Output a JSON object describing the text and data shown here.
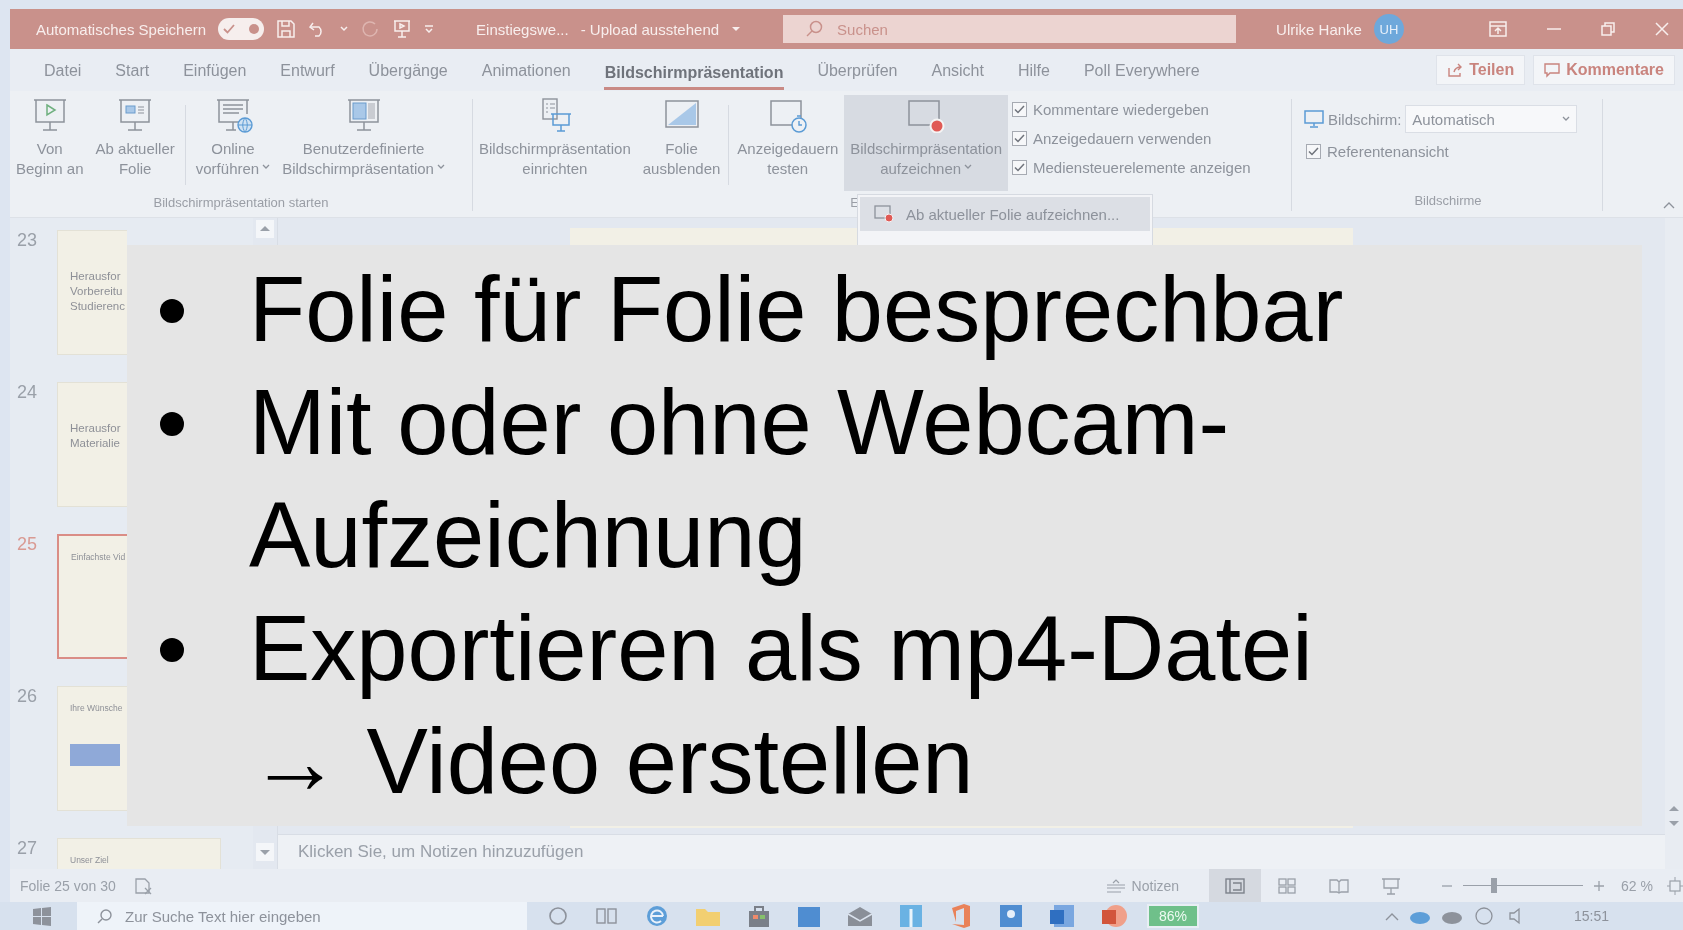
{
  "title_bar": {
    "autosave_label": "Automatisches Speichern",
    "autosave_on": true,
    "document_title": "Einstiegswe...",
    "upload_status": "- Upload ausstehend",
    "search_placeholder": "Suchen",
    "user_name": "Ulrike Hanke",
    "user_initials": "UH"
  },
  "tabs": [
    {
      "label": "Datei",
      "selected": false
    },
    {
      "label": "Start",
      "selected": false
    },
    {
      "label": "Einfügen",
      "selected": false
    },
    {
      "label": "Entwurf",
      "selected": false
    },
    {
      "label": "Übergänge",
      "selected": false
    },
    {
      "label": "Animationen",
      "selected": false
    },
    {
      "label": "Bildschirmpräsentation",
      "selected": true
    },
    {
      "label": "Überprüfen",
      "selected": false
    },
    {
      "label": "Ansicht",
      "selected": false
    },
    {
      "label": "Hilfe",
      "selected": false
    },
    {
      "label": "Poll Everywhere",
      "selected": false
    }
  ],
  "share_button": "Teilen",
  "comments_button": "Kommentare",
  "ribbon": {
    "groups": [
      {
        "label": "Bildschirmpräsentation starten",
        "commands": [
          {
            "kind": "from-start",
            "lines": [
              "Von",
              "Beginn an"
            ],
            "dropdown": false
          },
          {
            "kind": "from-current",
            "lines": [
              "Ab aktueller",
              "Folie"
            ],
            "dropdown": false
          },
          {
            "kind": "online",
            "lines": [
              "Online",
              "vorführen"
            ],
            "dropdown": true
          },
          {
            "kind": "custom",
            "lines": [
              "Benutzerdefinierte",
              "Bildschirmpräsentation"
            ],
            "dropdown": true
          }
        ]
      },
      {
        "label": "E",
        "commands": [
          {
            "kind": "setup",
            "lines": [
              "Bildschirmpräsentation",
              "einrichten"
            ],
            "dropdown": false
          },
          {
            "kind": "hide",
            "lines": [
              "Folie",
              "ausblenden"
            ],
            "dropdown": false
          },
          {
            "kind": "rehearse",
            "lines": [
              "Anzeigedauern",
              "testen"
            ],
            "dropdown": false
          },
          {
            "kind": "record",
            "lines": [
              "Bildschirmpräsentation",
              "aufzeichnen"
            ],
            "dropdown": true,
            "expanded": true
          }
        ],
        "checkboxes": [
          {
            "label": "Kommentare wiedergeben",
            "checked": true
          },
          {
            "label": "Anzeigedauern verwenden",
            "checked": true
          },
          {
            "label": "Mediensteuerelemente anzeigen",
            "checked": true
          }
        ]
      },
      {
        "label": "Bildschirme",
        "monitor": {
          "label": "Bildschirm:",
          "value": "Automatisch"
        },
        "checkboxes": [
          {
            "label": "Referentenansicht",
            "checked": true
          }
        ]
      }
    ]
  },
  "record_menu": {
    "items": [
      {
        "label": "Ab aktueller Folie aufzeichnen...",
        "selected": true
      }
    ]
  },
  "thumbnails": [
    {
      "number": "23",
      "kind": "title",
      "lines": [
        "Herausfor",
        "Vorbereitu",
        "Studierenc"
      ],
      "selected": false
    },
    {
      "number": "24",
      "kind": "title",
      "lines": [
        "Herausfor",
        "Materialie"
      ],
      "selected": false
    },
    {
      "number": "25",
      "kind": "heading",
      "lines": [
        "Einfachste Vid"
      ],
      "selected": true
    },
    {
      "number": "26",
      "kind": "diagram",
      "lines": [
        "Ihre Wünsche"
      ],
      "selected": false
    },
    {
      "number": "27",
      "kind": "heading",
      "lines": [
        "Unser Ziel"
      ],
      "selected": false
    }
  ],
  "notes_placeholder": "Klicken Sie, um Notizen hinzuzufügen",
  "status_bar": {
    "slide_info": "Folie 25 von 30",
    "notes_label": "Notizen",
    "views": [
      {
        "kind": "normal",
        "selected": true
      },
      {
        "kind": "sorter",
        "selected": false
      },
      {
        "kind": "reading",
        "selected": false
      },
      {
        "kind": "slideshow",
        "selected": false
      }
    ],
    "zoom": {
      "level": 0.26,
      "reading": "62 %"
    }
  },
  "taskbar": {
    "search_placeholder": "Zur Suche Text hier eingeben",
    "battery": "86%",
    "time": "15:51"
  },
  "overlay": {
    "bullets": [
      "Folie für Folie besprechbar",
      "Mit oder ohne Webcam-Aufzeichnung",
      "Exportieren als mp4-Datei → Video erstellen"
    ]
  }
}
